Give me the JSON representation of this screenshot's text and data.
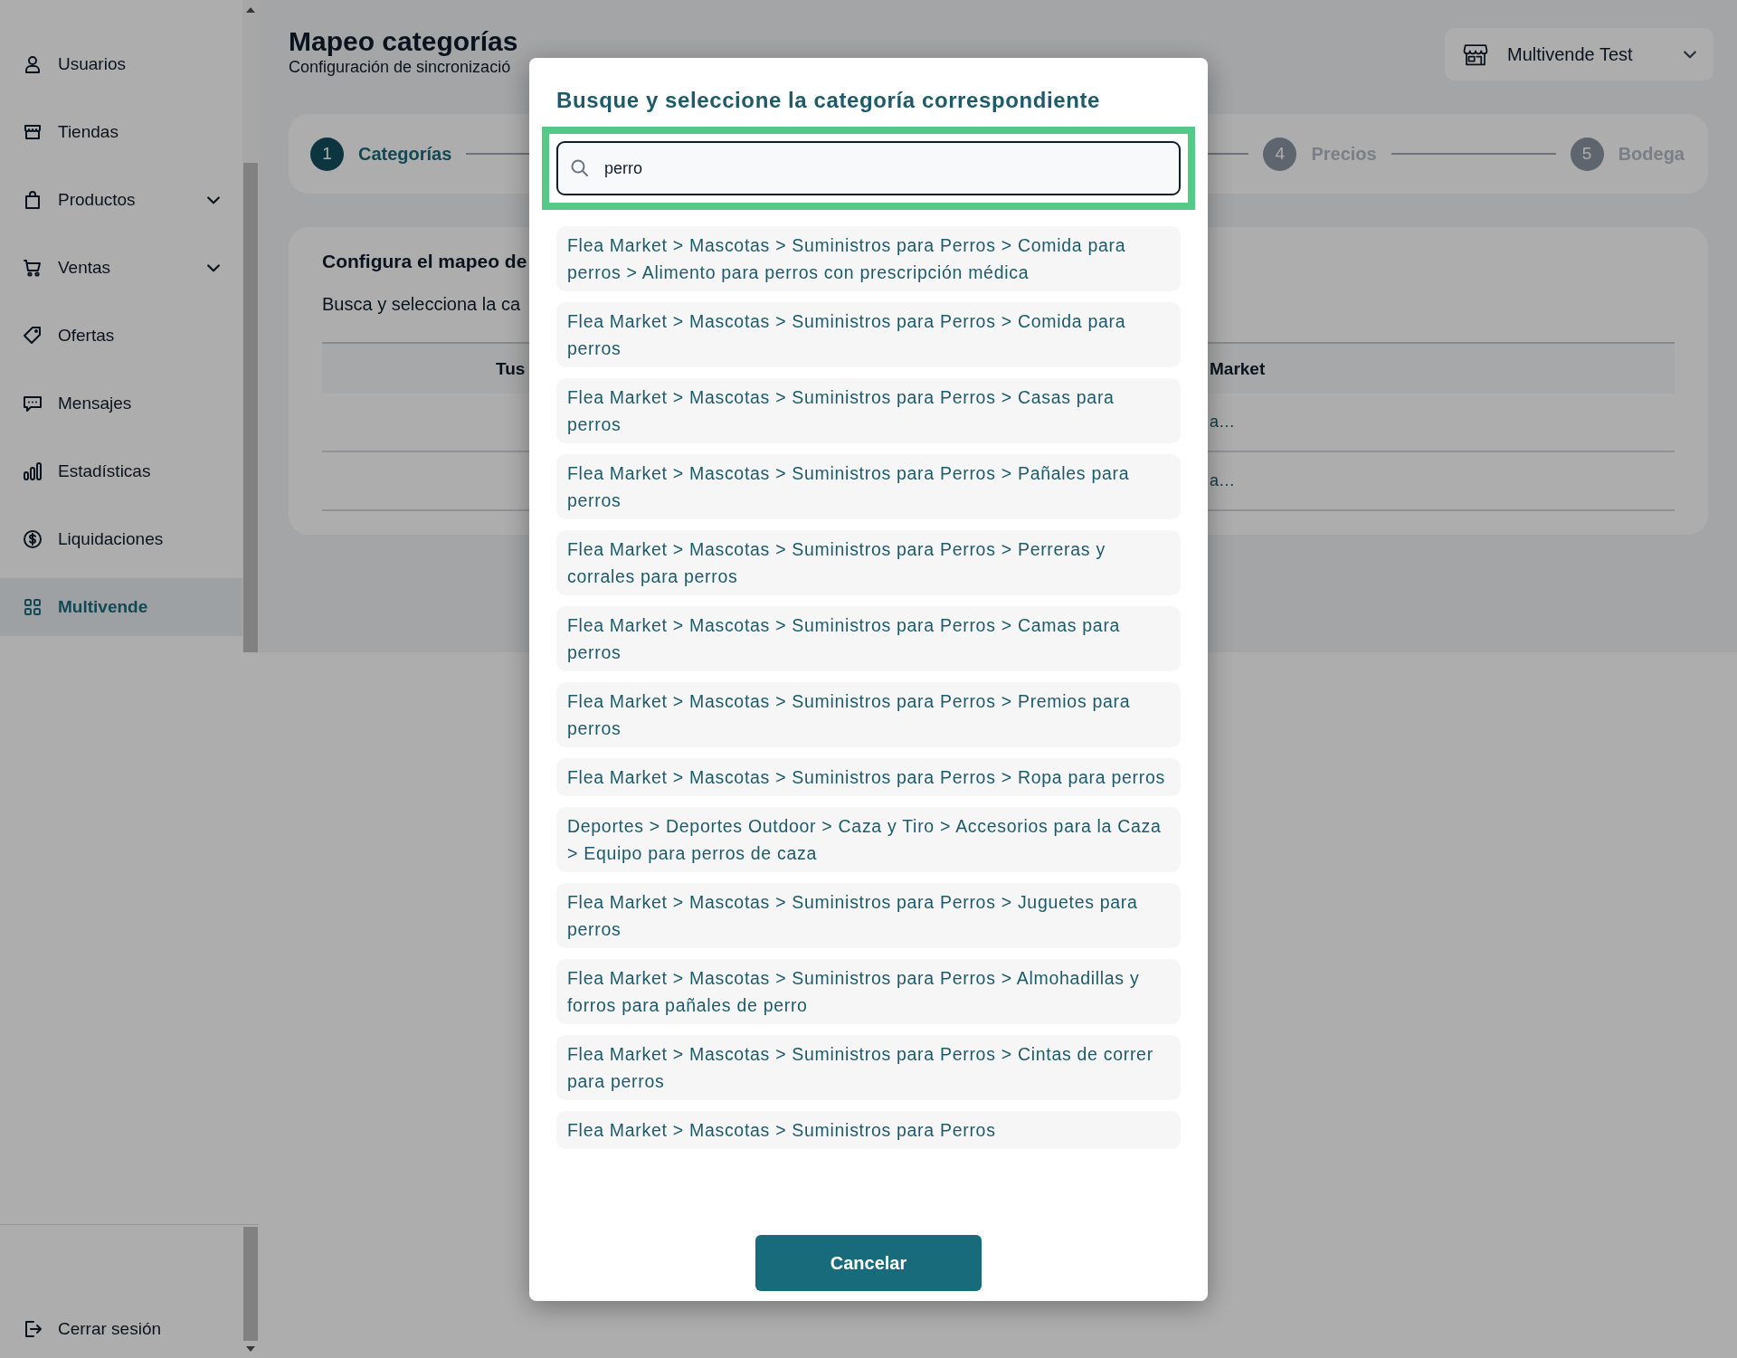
{
  "sidebar": {
    "items": [
      {
        "label": "Usuarios",
        "selected": false,
        "expandable": false
      },
      {
        "label": "Tiendas",
        "selected": false,
        "expandable": false
      },
      {
        "label": "Productos",
        "selected": false,
        "expandable": true
      },
      {
        "label": "Ventas",
        "selected": false,
        "expandable": true
      },
      {
        "label": "Ofertas",
        "selected": false,
        "expandable": false
      },
      {
        "label": "Mensajes",
        "selected": false,
        "expandable": false
      },
      {
        "label": "Estadísticas",
        "selected": false,
        "expandable": false
      },
      {
        "label": "Liquidaciones",
        "selected": false,
        "expandable": false
      },
      {
        "label": "Multivende",
        "selected": true,
        "expandable": false
      }
    ],
    "logout": "Cerrar sesión"
  },
  "header": {
    "title": "Mapeo categorías",
    "subtitle": "Configuración de sincronizació",
    "store_select": "Multivende Test"
  },
  "stepper": [
    {
      "number": "1",
      "label": "Categorías",
      "selected": true
    },
    {
      "number": "4",
      "label": "Precios",
      "selected": false
    },
    {
      "number": "5",
      "label": "Bodega",
      "selected": false
    }
  ],
  "config_card": {
    "title": "Configura el mapeo de",
    "description": "Busca y selecciona la ca",
    "table": {
      "columns": [
        "Tus",
        "Market"
      ],
      "rows": [
        {
          "column_2": "a…"
        },
        {
          "column_2": "a…"
        }
      ]
    }
  },
  "modal": {
    "title": "Busque y seleccione la categoría correspondiente",
    "search": {
      "value": "perro",
      "highlighted": true
    },
    "results": [
      "Flea Market > Mascotas > Suministros para Perros > Comida para perros > Alimento para perros con prescripción médica",
      "Flea Market > Mascotas > Suministros para Perros > Comida para perros",
      "Flea Market > Mascotas > Suministros para Perros > Casas para perros",
      "Flea Market > Mascotas > Suministros para Perros > Pañales para perros",
      "Flea Market > Mascotas > Suministros para Perros > Perreras y corrales para perros",
      "Flea Market > Mascotas > Suministros para Perros > Camas para perros",
      "Flea Market > Mascotas > Suministros para Perros > Premios para perros",
      "Flea Market > Mascotas > Suministros para Perros > Ropa para perros",
      "Deportes > Deportes Outdoor > Caza y Tiro > Accesorios para la Caza > Equipo para perros de caza",
      "Flea Market > Mascotas > Suministros para Perros > Juguetes para perros",
      "Flea Market > Mascotas > Suministros para Perros > Almohadillas y forros para pañales de perro",
      "Flea Market > Mascotas > Suministros para Perros > Cintas de correr para perros",
      "Flea Market > Mascotas > Suministros para Perros"
    ],
    "cancel": "Cancelar"
  }
}
